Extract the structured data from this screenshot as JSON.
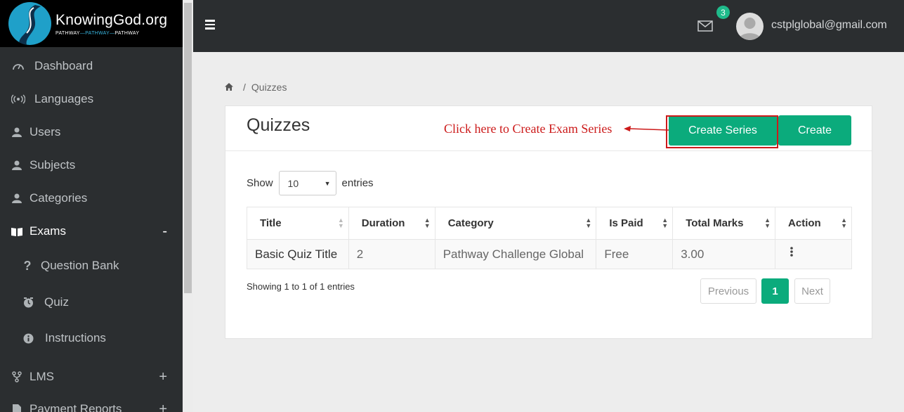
{
  "logo": {
    "title": "KnowingGod.org",
    "sub_a": "PATHWAY",
    "sub_b": "—PATHWAY—",
    "sub_c": "PATHWAY"
  },
  "sidebar": {
    "items": [
      {
        "label": "Dashboard",
        "icon": "dashboard-icon"
      },
      {
        "label": "Languages",
        "icon": "broadcast-icon"
      },
      {
        "label": "Users",
        "icon": "user-icon"
      },
      {
        "label": "Subjects",
        "icon": "user-icon"
      },
      {
        "label": "Categories",
        "icon": "user-icon"
      },
      {
        "label": "Exams",
        "icon": "book-icon",
        "toggle": "-"
      },
      {
        "label": "Question Bank",
        "icon": "question-icon"
      },
      {
        "label": "Quiz",
        "icon": "clock-icon"
      },
      {
        "label": "Instructions",
        "icon": "info-icon"
      },
      {
        "label": "LMS",
        "icon": "fork-icon",
        "toggle": "+"
      },
      {
        "label": "Payment Reports",
        "icon": "document-icon",
        "toggle": "+"
      }
    ]
  },
  "topbar": {
    "notification_count": "3",
    "user_email": "cstplglobal@gmail.com"
  },
  "breadcrumb": {
    "current": "Quizzes"
  },
  "page": {
    "title": "Quizzes",
    "annotation": "Click here to Create Exam Series",
    "create_series_label": "Create Series",
    "create_label": "Create",
    "show_label": "Show",
    "entries_label": "entries",
    "page_size": "10"
  },
  "table": {
    "columns": [
      "Title",
      "Duration",
      "Category",
      "Is Paid",
      "Total Marks",
      "Action"
    ],
    "rows": [
      [
        "Basic Quiz Title",
        "2",
        "Pathway Challenge Global",
        "Free",
        "3.00"
      ]
    ]
  },
  "footer": {
    "info": "Showing 1 to 1 of 1 entries",
    "previous": "Previous",
    "current_page": "1",
    "next": "Next"
  },
  "colors": {
    "accent": "#0bab7c",
    "annotation": "#cc1a1a",
    "sidebar": "#2b2e30"
  }
}
